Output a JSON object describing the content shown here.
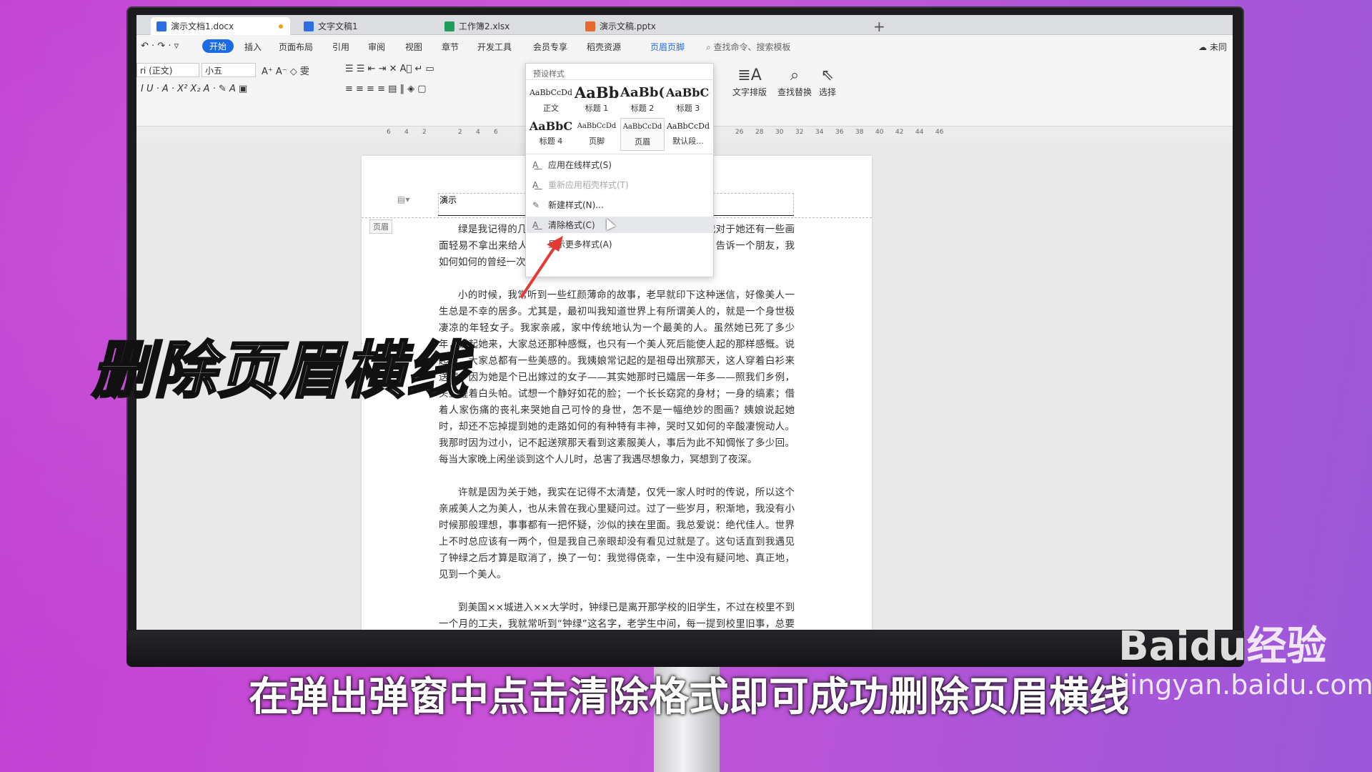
{
  "tabs": [
    {
      "label": "演示文档1.docx",
      "color": "#2b6fe2"
    },
    {
      "label": "文字文稿1",
      "color": "#2b6fe2"
    },
    {
      "label": "工作簿2.xlsx",
      "color": "#1e9e5a"
    },
    {
      "label": "演示文稿.pptx",
      "color": "#e8692d"
    }
  ],
  "menu": {
    "start": "开始",
    "items": [
      "插入",
      "页面布局",
      "引用",
      "审阅",
      "视图",
      "章节",
      "开发工具",
      "会员专享",
      "稻壳资源"
    ],
    "hf": "页眉页脚",
    "search": "查找命令、搜索模板",
    "sync": "未同"
  },
  "font": {
    "name": "ri (正文)",
    "size": "小五"
  },
  "tools": {
    "layout": "文字排版",
    "find": "查找替换",
    "select": "选择"
  },
  "ruler": [
    "6",
    "4",
    "2",
    "2",
    "4",
    "6",
    "26",
    "28",
    "30",
    "32",
    "34",
    "36",
    "38",
    "40",
    "42",
    "44",
    "46"
  ],
  "document": {
    "header_text": "演示",
    "header_tag": "页眉",
    "paragraphs": [
      "绿是我记得的几个真正员得起“美人”这称呼的人物，所以我对于她还有一些画面轻易不拿出来给人看，我也就轻易的不和人家谈她。兴奋地，告诉一个朋友，我如何如何的曾经一次看到真正的美人。",
      "小的时候，我常听到一些红颜薄命的故事，老早就印下这种迷信，好像美人一生总是不幸的居多。尤其是，最初叫我知道世界上有所谓美人的，就是一个身世极凄凉的年轻女子。我家亲戚，家中传统地认为一个最美的人。虽然她已死了多少年，说起她来，大家总还那种感慨，也只有一个美人死后能使人起的那样感慨。说起她，大家总都有一些美感的。我姨娘常记起的是祖母出殡那天，这人穿着白衫来送殡。因为她是个已出嫁过的女子——其实她那时已孀居一年多——照我们乡例，头上缠着白头帕。试想一个静好如花的脸；一个长长窈窕的身材；一身的缟素；借着人家伤痛的丧礼来哭她自己可怜的身世，怎不是一幅绝妙的图画？姨娘说起她时，却还不忘掉提到她的走路如何的有种特有丰神，哭时又如何的辛酸凄惋动人。我那时因为过小，记不起送殡那天看到这素服美人，事后为此不知惆怅了多少回。每当大家晚上闲坐谈到这个人儿时，总害了我遇尽想象力，冥想到了夜深。",
      "许就是因为关于她，我实在记得不太清楚，仅凭一家人时时的传说，所以这个亲戚美人之为美人，也从未曾在我心里疑问过。过了一些岁月，积渐地，我没有小时候那般理想，事事都有一把怀疑，沙似的挟在里面。我总爱说：绝代佳人。世界上不时总应该有一两个，但是我自己亲眼却没有看见过就是了。这句话直到我遇见了钟绿之后才算是取消了，换了一句：我觉得侥幸，一生中没有疑问地、真正地，见到一个美人。",
      "到美国××城进入××大学时，钟绿已是离开那学校的旧学生，不过在校里不到一个月的工夫，我就常听到“钟绿”这名字，老学生中间，每一提到校里旧事，总要联想到她。无疑的，她是他们中间最受崇拜的人物。"
    ]
  },
  "dropdown": {
    "title": "预设样式",
    "styles": [
      {
        "preview": "AaBbCcDd",
        "name": "正文"
      },
      {
        "preview": "AaBb",
        "name": "标题 1"
      },
      {
        "preview": "AaBb(",
        "name": "标题 2"
      },
      {
        "preview": "AaBbC(",
        "name": "标题 3"
      },
      {
        "preview": "AaBbC",
        "name": "标题 4"
      },
      {
        "preview": "AaBbCcDd",
        "name": "页脚"
      },
      {
        "preview": "AaBbCcDd",
        "name": "页眉"
      },
      {
        "preview": "AaBbCcDd",
        "name": "默认段..."
      }
    ],
    "items": [
      "应用在线样式(S)",
      "重新应用稻壳样式(T)",
      "新建样式(N)...",
      "清除格式(C)",
      "显示更多样式(A)"
    ]
  },
  "overlay": {
    "title": "删除页眉横线",
    "caption": "在弹出弹窗中点击清除格式即可成功删除页眉横线"
  },
  "watermark": {
    "brand": "Baidu经验",
    "url": "jingyan.baidu.com"
  }
}
